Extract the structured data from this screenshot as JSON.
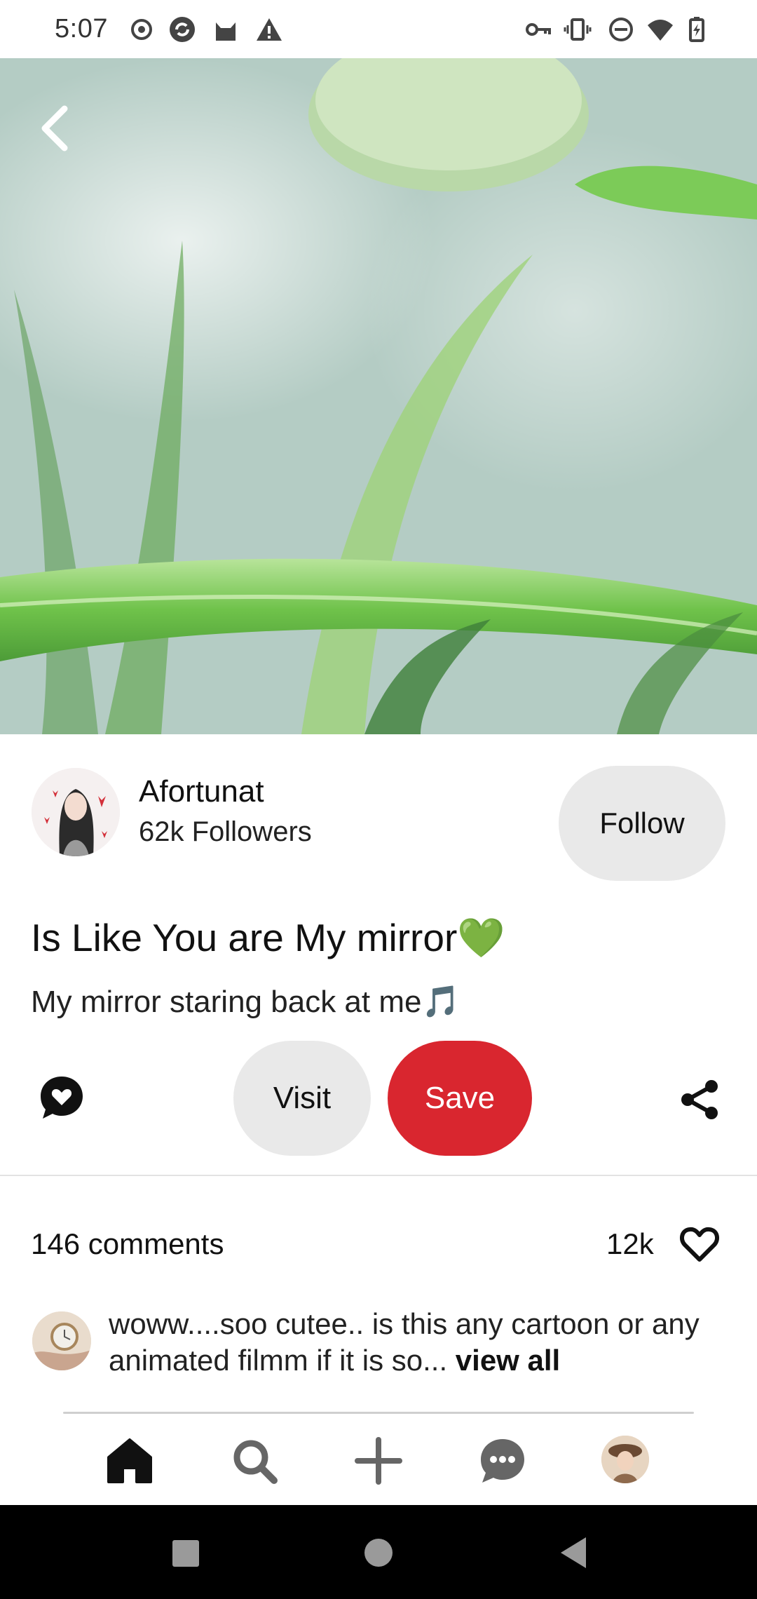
{
  "status_bar": {
    "time": "5:07",
    "left_icons": [
      "record-icon",
      "sync-icon",
      "cat-icon",
      "warning-icon"
    ],
    "right_icons": [
      "vpn-key-icon",
      "vibrate-icon",
      "dnd-icon",
      "wifi-icon",
      "battery-charging-icon"
    ]
  },
  "hero": {
    "back_icon": "chevron-left-icon"
  },
  "creator": {
    "name": "Afortunat",
    "followers": "62k Followers",
    "follow_label": "Follow"
  },
  "pin": {
    "title": "Is Like You are My mirror💚",
    "description": "My mirror staring back at me🎵"
  },
  "actions": {
    "comment_icon": "comment-heart-icon",
    "visit_label": "Visit",
    "save_label": "Save",
    "share_icon": "share-icon",
    "save_color": "#d9262f"
  },
  "comments": {
    "count": "146 comments",
    "likes": "12k",
    "first_comment": "woww....soo cutee.. is this any cartoon or any animated filmm if it is so...",
    "view_all": "view all"
  },
  "bottom_nav": {
    "items": [
      "home-icon",
      "search-icon",
      "create-icon",
      "messages-icon",
      "profile-avatar"
    ]
  }
}
